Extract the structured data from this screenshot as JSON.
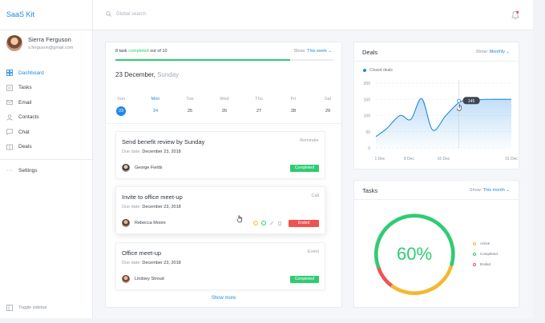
{
  "app": {
    "title": "SaaS Kit"
  },
  "colors": {
    "accent": "#1e88e5",
    "completed": "#2ecc71",
    "ended": "#ef5350",
    "active": "#f5b82e"
  },
  "user": {
    "name": "Sierra Ferguson",
    "email": "s.ferguson@gmail.com"
  },
  "nav": [
    {
      "label": "Dashboard",
      "icon": "dashboard-icon",
      "active": true
    },
    {
      "label": "Tasks",
      "icon": "tasks-icon"
    },
    {
      "label": "Email",
      "icon": "mail-icon"
    },
    {
      "label": "Contacts",
      "icon": "contacts-icon"
    },
    {
      "label": "Chat",
      "icon": "chat-icon"
    },
    {
      "label": "Deals",
      "icon": "deals-icon"
    }
  ],
  "settings_label": "Settings",
  "toggle_sidebar_label": "Toggle sidebar",
  "search": {
    "placeholder": "Global search"
  },
  "task_summary": {
    "count": "8 task",
    "completed_word": "completed",
    "rest": "out of 10",
    "progress": 0.8,
    "show_label": "Show:",
    "show_value": "This week"
  },
  "date": {
    "main": "23 December,",
    "weekday": "Sunday"
  },
  "week": [
    {
      "day": "Sun",
      "num": "23",
      "selected": true
    },
    {
      "day": "Mon",
      "num": "24",
      "today": true
    },
    {
      "day": "Tue",
      "num": "25"
    },
    {
      "day": "Wed",
      "num": "26"
    },
    {
      "day": "Thu",
      "num": "27"
    },
    {
      "day": "Fri",
      "num": "28"
    },
    {
      "day": "Sat",
      "num": "29"
    }
  ],
  "tasks": [
    {
      "title": "Send benefit review by Sunday",
      "type": "Reminder",
      "due_label": "Due date:",
      "due": "December 23, 2018",
      "person": "George Fields",
      "status": "Completed"
    },
    {
      "title": "Invite to office meet-up",
      "type": "Call",
      "due_label": "Due date:",
      "due": "December 23, 2018",
      "person": "Rebecca Moore",
      "status": "Ended"
    },
    {
      "title": "Office meet-up",
      "type": "Event",
      "due_label": "Due date:",
      "due": "December 23, 2018",
      "person": "Lindsey Stroud",
      "status": "Completed"
    }
  ],
  "show_more": "Show more",
  "deals": {
    "title": "Deals",
    "show_label": "Show:",
    "show_value": "Monthly",
    "legend": "Closed deals",
    "tooltip": "145"
  },
  "chart_data": {
    "type": "area",
    "x": [
      "1 Dec",
      "8 Dec",
      "16 Dec",
      "31 Dec"
    ],
    "ylim": [
      0,
      200
    ],
    "yticks": [
      "200",
      "150",
      "100",
      "50",
      "0"
    ],
    "series": [
      {
        "name": "Closed deals",
        "points": [
          [
            0,
            35
          ],
          [
            2.5,
            60
          ],
          [
            5.5,
            100
          ],
          [
            8,
            88
          ],
          [
            10.5,
            152
          ],
          [
            13,
            55
          ],
          [
            16,
            100
          ],
          [
            19,
            140
          ],
          [
            21,
            146
          ],
          [
            25,
            150
          ],
          [
            31,
            150
          ]
        ]
      }
    ],
    "highlight_x": 19,
    "highlight_value": 145
  },
  "tasks_card": {
    "title": "Tasks",
    "show_label": "Show:",
    "show_value": "This month",
    "percent": "60%",
    "legend": [
      {
        "label": "Active",
        "color": "#f5b82e"
      },
      {
        "label": "Completed",
        "color": "#2ecc71"
      },
      {
        "label": "Ended",
        "color": "#ef5350"
      }
    ]
  }
}
